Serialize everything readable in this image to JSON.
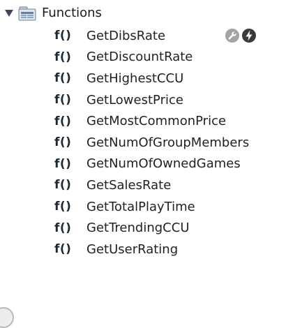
{
  "folder": {
    "label": "Functions",
    "expanded": true,
    "caret_icon": "triangle-down-icon",
    "icon": "folder-table-icon"
  },
  "function_prefix": "f()",
  "functions": [
    {
      "name": "GetDibsRate"
    },
    {
      "name": "GetDiscountRate"
    },
    {
      "name": "GetHighestCCU"
    },
    {
      "name": "GetLowestPrice"
    },
    {
      "name": "GetMostCommonPrice"
    },
    {
      "name": "GetNumOfGroupMembers"
    },
    {
      "name": "GetNumOfOwnedGames"
    },
    {
      "name": "GetSalesRate"
    },
    {
      "name": "GetTotalPlayTime"
    },
    {
      "name": "GetTrendingCCU"
    },
    {
      "name": "GetUserRating"
    }
  ],
  "hover_actions": {
    "row_index": 0,
    "edit_icon": "wrench-icon",
    "run_icon": "lightning-icon"
  },
  "colors": {
    "text": "#1a1a1a",
    "badge": "#1e2a33",
    "icon_gray": "#9a9a9a",
    "icon_dark": "#3a3a3a",
    "folder_blue": "#5a7fb0"
  }
}
